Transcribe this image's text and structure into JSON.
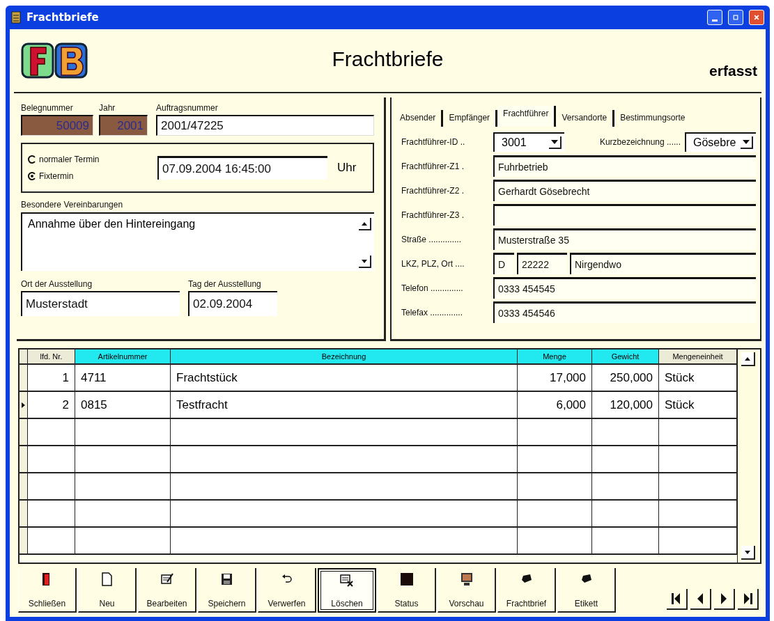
{
  "window": {
    "title": "Frachtbriefe"
  },
  "header": {
    "title": "Frachtbriefe",
    "status": "erfasst"
  },
  "document": {
    "fields": [
      {
        "label": "Belegnummer",
        "value": "50009",
        "kind": "locked"
      },
      {
        "label": "Jahr",
        "value": "2001",
        "kind": "locked"
      },
      {
        "label": "Auftragsnummer",
        "value": "2001/47225",
        "kind": "text"
      }
    ],
    "schedule": {
      "options": [
        {
          "label": "normaler Termin",
          "selected": false
        },
        {
          "label": "Fixtermin",
          "selected": true
        }
      ],
      "value": "07.09.2004 16:45:00",
      "unit": "Uhr"
    },
    "agreements": {
      "label": "Besondere Vereinbarungen",
      "value": "Annahme über den Hintereingang"
    },
    "issue_place": {
      "label": "Ort der Ausstellung",
      "value": "Musterstadt"
    },
    "issue_date": {
      "label": "Tag der Ausstellung",
      "value": "02.09.2004"
    }
  },
  "tabs": [
    {
      "label": "Absender",
      "selected": false
    },
    {
      "label": "Empfänger",
      "selected": false
    },
    {
      "label": "Frachtführer",
      "selected": true
    },
    {
      "label": "Versandorte",
      "selected": false
    },
    {
      "label": "Bestimmungsorte",
      "selected": false
    }
  ],
  "carrier": [
    {
      "kind": "combo",
      "label": "Frachtführer-ID ..",
      "value": "3001",
      "extra_label": "Kurzbezeichnung ......",
      "extra_value": "Gösebre"
    },
    {
      "kind": "text",
      "label": "Frachtführer-Z1 .",
      "value": "Fuhrbetrieb"
    },
    {
      "kind": "text",
      "label": "Frachtführer-Z2 .",
      "value": "Gerhardt Gösebrecht"
    },
    {
      "kind": "text",
      "label": "Frachtführer-Z3 ."
    },
    {
      "kind": "text",
      "label": "Straße ..............",
      "value": "Musterstraße 35"
    },
    {
      "kind": "split",
      "label": "LKZ, PLZ, Ort ....",
      "values": [
        "D",
        "22222",
        "Nirgendwo"
      ]
    },
    {
      "kind": "text",
      "label": "Telefon ..............",
      "value": "0333 454545"
    },
    {
      "kind": "text",
      "label": "Telefax ..............",
      "value": "0333 454546"
    }
  ],
  "table": {
    "columns": [
      {
        "label": "lfd. Nr.",
        "kind": "number",
        "highlighted": false
      },
      {
        "label": "Artikelnummer",
        "kind": "text",
        "highlighted": true
      },
      {
        "label": "Bezeichnung",
        "kind": "text",
        "highlighted": true
      },
      {
        "label": "Menge",
        "kind": "number",
        "highlighted": true
      },
      {
        "label": "Gewicht",
        "kind": "number",
        "highlighted": true
      },
      {
        "label": "Mengeneinheit",
        "kind": "text",
        "highlighted": false
      }
    ],
    "rows": [
      {
        "cells": [
          "1",
          "4711",
          "Frachtstück",
          "17,000",
          "250,000",
          "Stück"
        ],
        "selected": false
      },
      {
        "cells": [
          "2",
          "0815",
          "Testfracht",
          "6,000",
          "120,000",
          "Stück"
        ],
        "selected": true
      }
    ]
  },
  "toolbar": [
    {
      "label": "Schließen",
      "kind": "door",
      "selected": false
    },
    {
      "label": "Neu",
      "kind": "page",
      "selected": false
    },
    {
      "label": "Bearbeiten",
      "kind": "edit",
      "selected": false
    },
    {
      "label": "Speichern",
      "kind": "disk",
      "selected": false
    },
    {
      "label": "Verwerfen",
      "kind": "undo",
      "selected": false
    },
    {
      "label": "Löschen",
      "kind": "delete",
      "selected": true
    },
    {
      "label": "Status",
      "kind": "square",
      "selected": false
    },
    {
      "label": "Vorschau",
      "kind": "monitor",
      "selected": false
    },
    {
      "label": "Frachtbrief",
      "kind": "tag",
      "selected": false
    },
    {
      "label": "Etikett",
      "kind": "tag",
      "selected": false
    }
  ]
}
